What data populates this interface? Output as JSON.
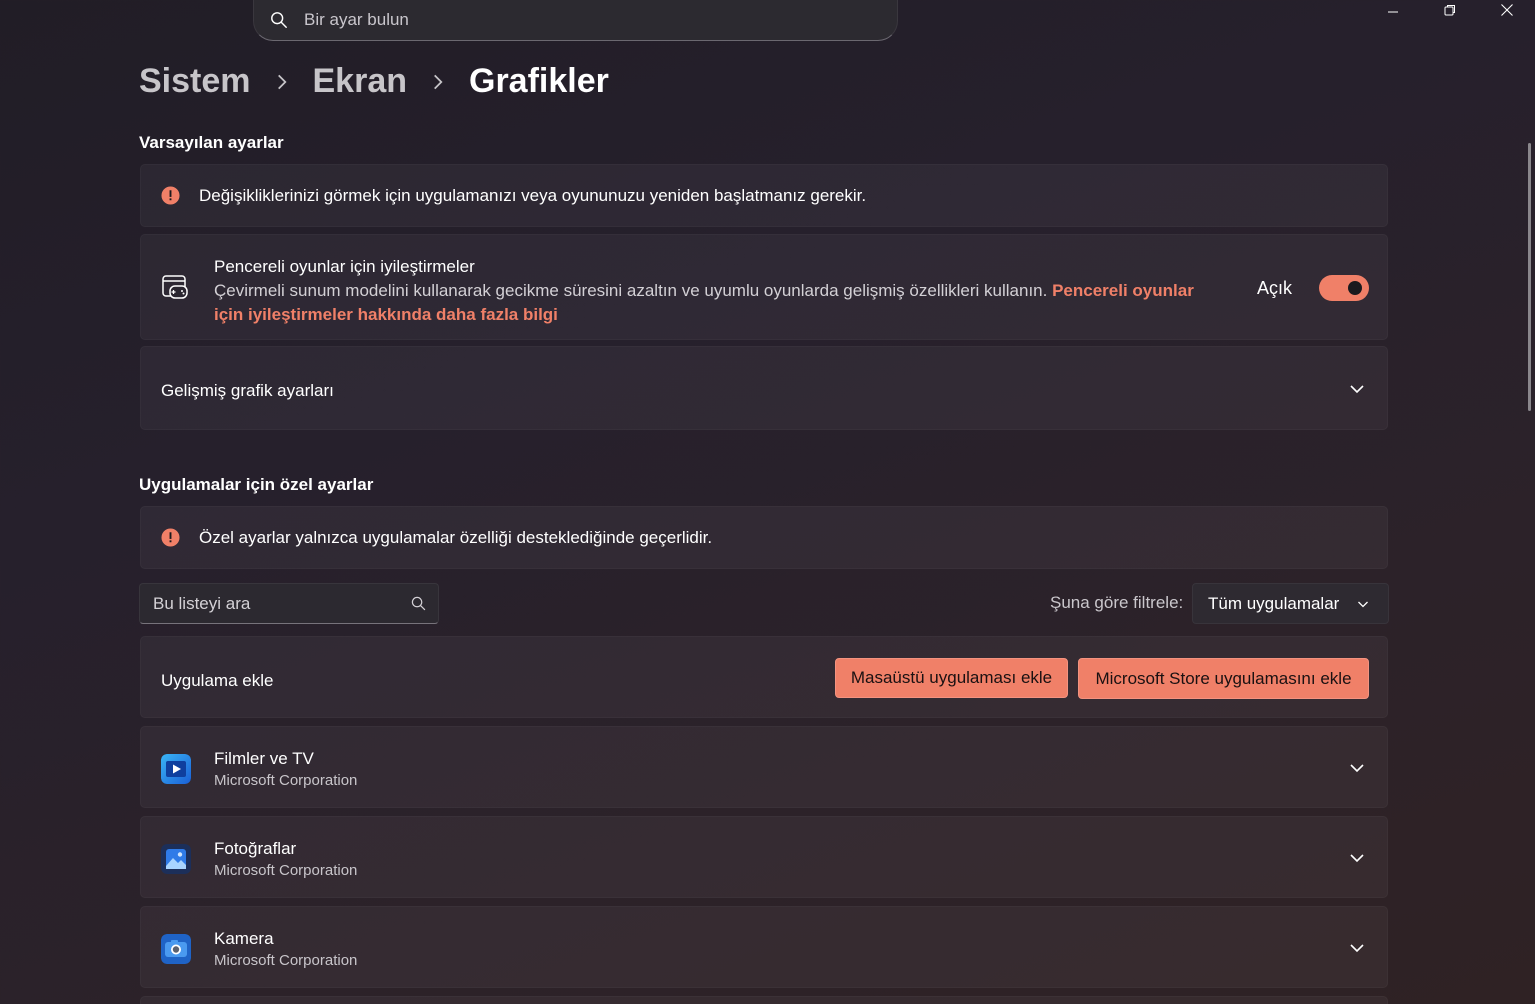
{
  "search": {
    "placeholder": "Bir ayar bulun"
  },
  "breadcrumb": {
    "items": [
      "Sistem",
      "Ekran",
      "Grafikler"
    ]
  },
  "default_settings": {
    "title": "Varsayılan ayarlar",
    "info": "Değişikliklerinizi görmek için uygulamanızı veya oyununuzu yeniden başlatmanız gerekir.",
    "windowed": {
      "title": "Pencereli oyunlar için iyileştirmeler",
      "desc": "Çevirmeli sunum modelini kullanarak gecikme süresini azaltın ve uyumlu oyunlarda gelişmiş özellikleri kullanın.",
      "link": "Pencereli oyunlar için iyileştirmeler hakkında daha fazla bilgi",
      "state": "Açık",
      "on": true
    },
    "advanced": "Gelişmiş grafik ayarları"
  },
  "app_settings": {
    "title": "Uygulamalar için özel ayarlar",
    "info": "Özel ayarlar yalnızca uygulamalar özelliği desteklediğinde geçerlidir.",
    "list_search_placeholder": "Bu listeyi ara",
    "filter_label": "Şuna göre filtrele:",
    "filter_value": "Tüm uygulamalar",
    "add_label": "Uygulama ekle",
    "add_desktop": "Masaüstü uygulaması ekle",
    "add_store": "Microsoft Store uygulamasını ekle",
    "apps": [
      {
        "name": "Filmler ve TV",
        "publisher": "Microsoft Corporation",
        "icon": "movies-tv-icon"
      },
      {
        "name": "Fotoğraflar",
        "publisher": "Microsoft Corporation",
        "icon": "photos-icon"
      },
      {
        "name": "Kamera",
        "publisher": "Microsoft Corporation",
        "icon": "camera-icon"
      }
    ]
  },
  "colors": {
    "accent": "#f08068",
    "background": "#241f28"
  }
}
